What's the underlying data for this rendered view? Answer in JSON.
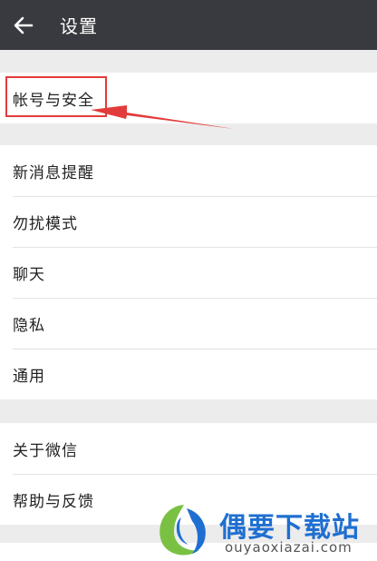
{
  "header": {
    "title": "设置",
    "back_icon": "arrow-left-icon"
  },
  "groups": [
    {
      "items": [
        {
          "label": "帐号与安全"
        }
      ]
    },
    {
      "items": [
        {
          "label": "新消息提醒"
        },
        {
          "label": "勿扰模式"
        },
        {
          "label": "聊天"
        },
        {
          "label": "隐私"
        },
        {
          "label": "通用"
        }
      ]
    },
    {
      "items": [
        {
          "label": "关于微信"
        },
        {
          "label": "帮助与反馈"
        }
      ]
    }
  ],
  "annotation": {
    "color": "#e23b3b"
  },
  "watermark": {
    "title": "偶要下载站",
    "url": "ouyaoxiazai.com"
  },
  "colors": {
    "topbar": "#393a3f",
    "background": "#ececec",
    "brand_blue": "#1f6fd1",
    "brand_green": "#7ac143"
  }
}
